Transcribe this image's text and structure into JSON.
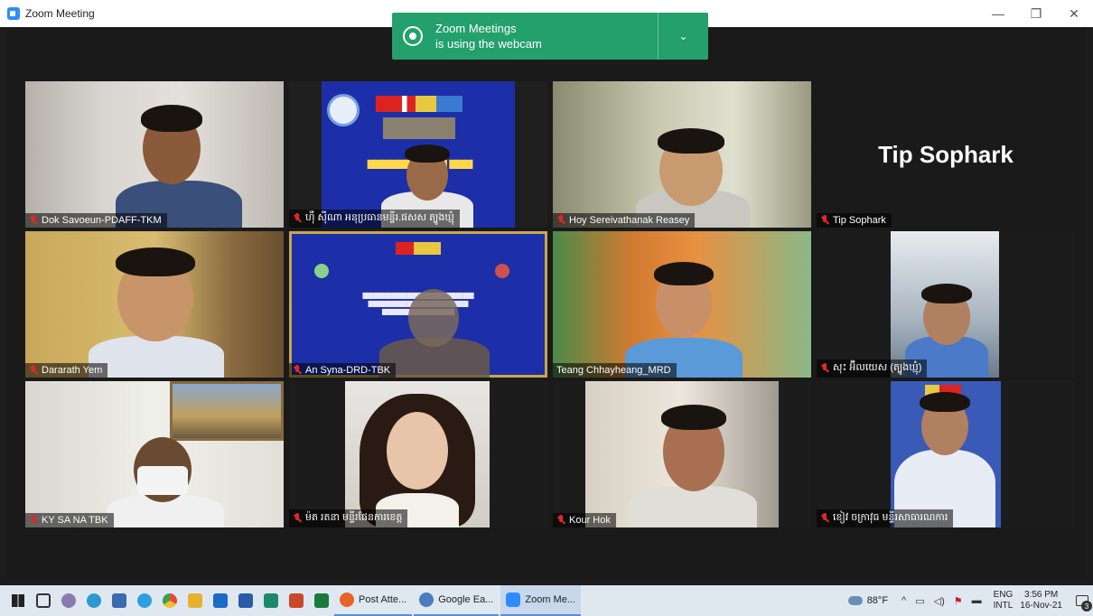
{
  "window": {
    "title": "Zoom Meeting",
    "controls": {
      "minimize": "—",
      "restore": "❐",
      "close": "✕"
    }
  },
  "notification": {
    "line1": "Zoom Meetings",
    "line2": "is using the webcam",
    "chevron": "⌄"
  },
  "participants": [
    {
      "name": "Dok Savoeun-PDAFF-TKM"
    },
    {
      "name": "ហ៊ឹ ស៊ីណា អនុប្រធានមន្ទីរ.ផសស ត្បូងឃ្មុំ"
    },
    {
      "name": "Hoy Sereivathanak Reasey"
    },
    {
      "name": "Tip Sophark",
      "display_name": "Tip Sophark"
    },
    {
      "name": "Dararath Yem"
    },
    {
      "name": "An Syna-DRD-TBK"
    },
    {
      "name": "Teang Chhayheang_MRD"
    },
    {
      "name": "សុះ អ៊ីលយេស (ត្បូងឃ្មុំ)"
    },
    {
      "name": "KY SA NA TBK"
    },
    {
      "name": "ម៉ត រតនា មន្ទីរផែនការខេត្ត"
    },
    {
      "name": "Kour Hok"
    },
    {
      "name": "ខៀវ ចក្រាវុធ មន្ទីរសាធារណការ"
    }
  ],
  "taskbar": {
    "apps": [
      {
        "label": "Post Atte...",
        "color": "#e8632b"
      },
      {
        "label": "Google Ea...",
        "color": "#4a7dbf"
      },
      {
        "label": "Zoom Me...",
        "color": "#2d8cff"
      }
    ],
    "weather": "88°F",
    "tray_icons": [
      "^",
      "▭",
      "◁)",
      "⚑",
      "▬"
    ],
    "lang_top": "ENG",
    "lang_bottom": "INTL",
    "time": "3:56 PM",
    "date": "16-Nov-21",
    "notifications": "3"
  },
  "colors": {
    "notification_bg": "#23a06b",
    "active_speaker_border": "#e4e430",
    "muted_mic": "#e02828",
    "poster_blue": "#1c2fa8"
  }
}
